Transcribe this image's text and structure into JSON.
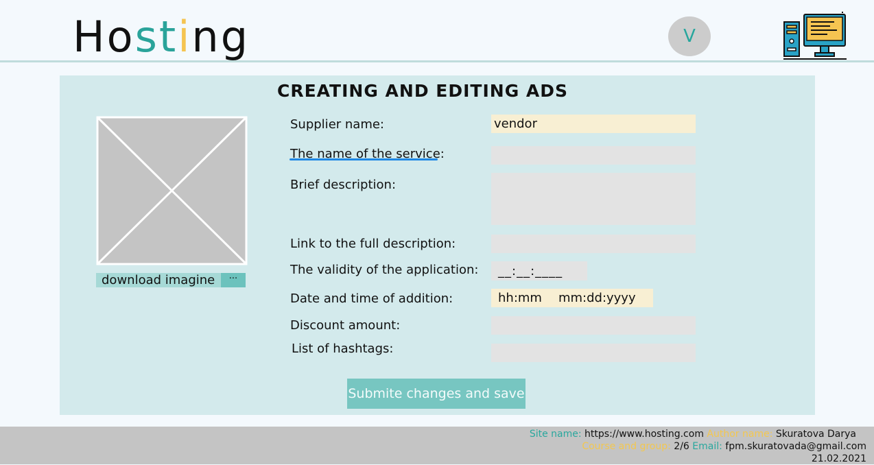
{
  "header": {
    "logo": {
      "part1": "Ho",
      "part2": "s",
      "part3": "t",
      "part4": "i",
      "part5": "ng"
    },
    "avatar_letter": "V",
    "icon": "computer-icon"
  },
  "panel": {
    "title": "CREATING AND EDITING ADS",
    "image": {
      "download_label": "download imagine",
      "browse_label": "···"
    },
    "fields": {
      "supplier_name": {
        "label": "Supplier name:",
        "value": "vendor"
      },
      "service_name": {
        "label": "The name of the service:",
        "value": ""
      },
      "brief_description": {
        "label": "Brief description:",
        "value": ""
      },
      "full_description_link": {
        "label": "Link to the full description:",
        "value": ""
      },
      "validity": {
        "label": "The validity of the application:",
        "value": "__:__:____"
      },
      "date_added": {
        "label": "Date and time of addition:",
        "time": "hh:mm",
        "date": "mm:dd:yyyy"
      },
      "discount": {
        "label": "Discount amount:",
        "value": ""
      },
      "hashtags": {
        "label": "List of hashtags:",
        "value": ""
      }
    },
    "submit_label": "Submite changes and save"
  },
  "footer": {
    "site_key": "Site name:",
    "site_value": "https://www.hosting.com",
    "author_key": "Author name:",
    "author_value": "Skuratova Darya",
    "course_key": "Course and group:",
    "course_value": "2/6",
    "email_key": "Email:",
    "email_value": "fpm.skuratovada@gmail.com",
    "date": "21.02.2021"
  },
  "colors": {
    "accent_teal": "#2aa39a",
    "accent_yellow": "#f5c451",
    "panel_bg": "#d3eaec",
    "button": "#77c6c1"
  }
}
